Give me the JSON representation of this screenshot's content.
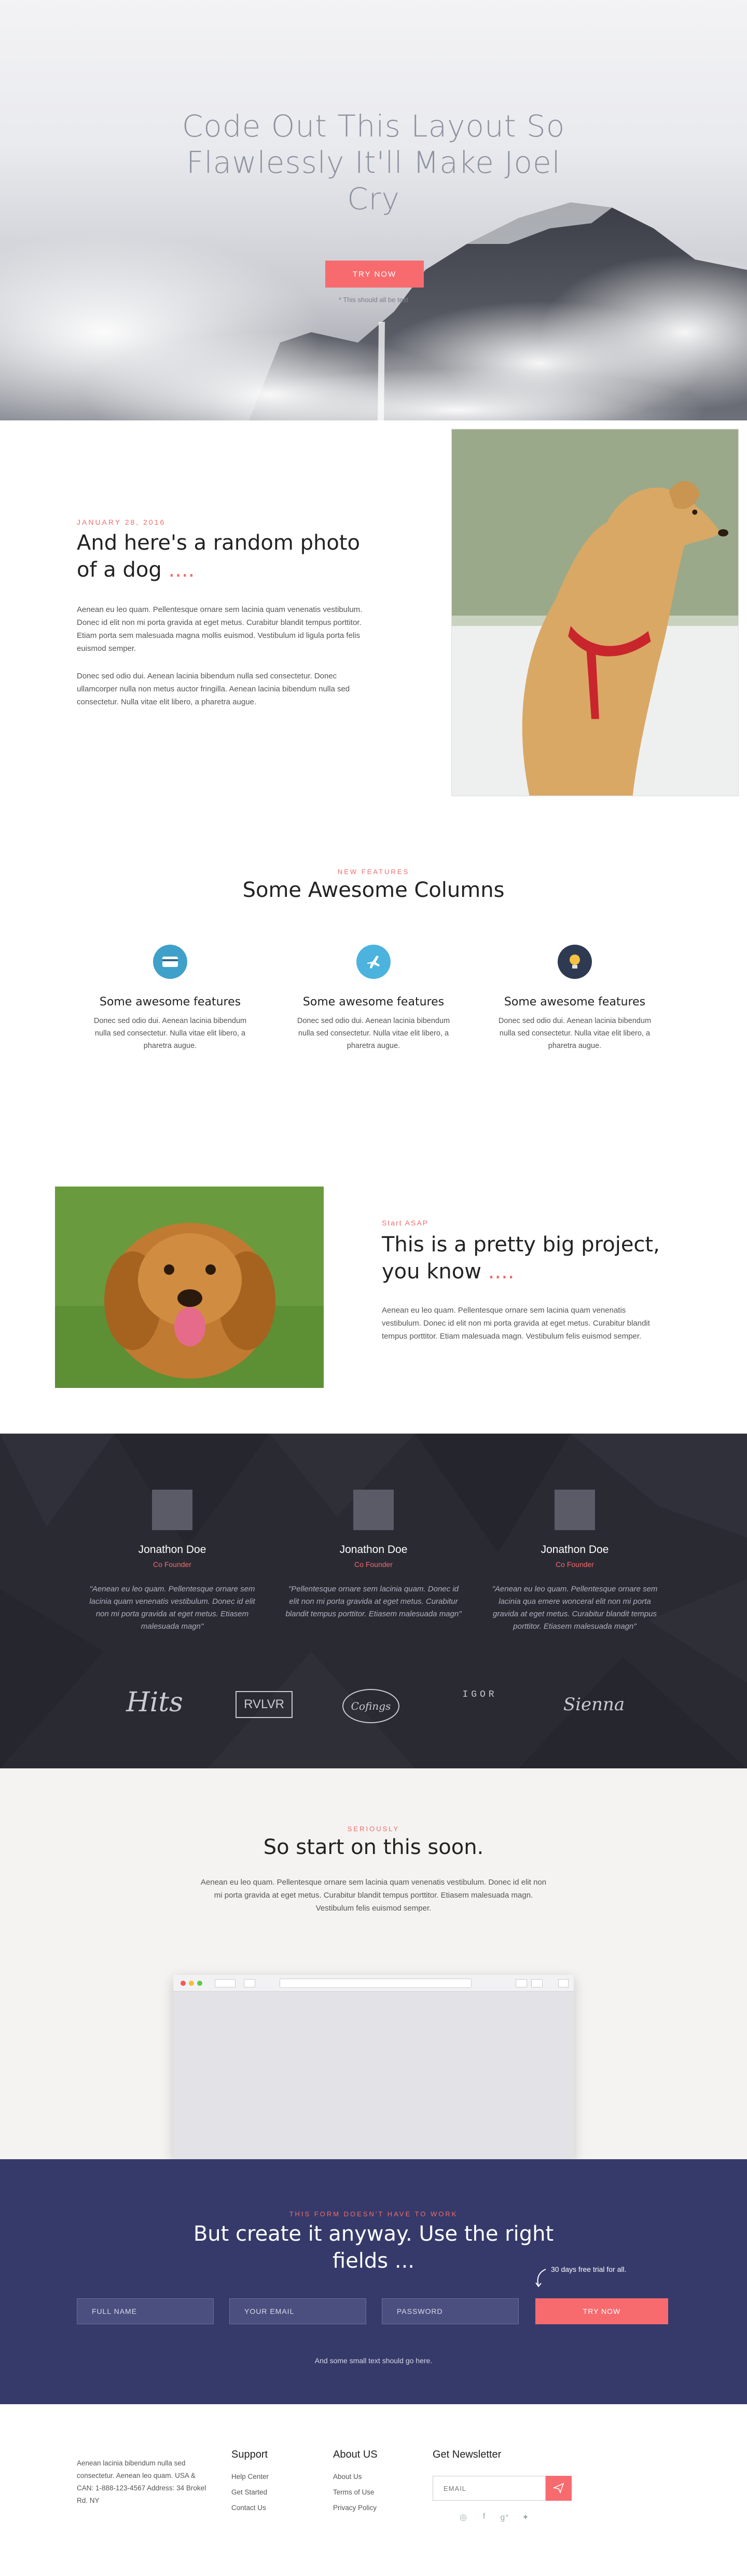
{
  "hero": {
    "title": "Code Out This Layout So Flawlessly It'll Make Joel Cry",
    "cta": "TRY NOW",
    "note": "* This should all be text"
  },
  "article": {
    "date": "JANUARY 28, 2016",
    "title": "And here's a random photo of a dog",
    "title_accent": "....",
    "para1": "Aenean eu leo quam. Pellentesque ornare sem lacinia quam venenatis vestibulum. Donec id elit non mi porta gravida at eget metus. Curabitur blandit tempus porttitor. Etiam porta sem malesuada magna mollis euismod. Vestibulum id ligula porta felis euismod semper.",
    "para2": "Donec sed odio dui. Aenean lacinia bibendum nulla sed consectetur. Donec ullamcorper nulla non metus auctor fringilla. Aenean lacinia bibendum nulla sed consectetur. Nulla vitae elit libero, a pharetra augue."
  },
  "features": {
    "eyebrow": "NEW FEATURES",
    "title": "Some Awesome Columns",
    "items": [
      {
        "icon": "credit-card-icon",
        "color": "#3fa1c9",
        "title": "Some awesome features",
        "text": "Donec sed odio dui. Aenean lacinia bibendum nulla sed consectetur. Nulla vitae elit libero, a pharetra augue."
      },
      {
        "icon": "airplane-icon",
        "color": "#4bb3de",
        "title": "Some awesome features",
        "text": "Donec sed odio dui. Aenean lacinia bibendum nulla sed consectetur. Nulla vitae elit libero, a pharetra augue."
      },
      {
        "icon": "lightbulb-icon",
        "color": "#2e3a52",
        "title": "Some awesome features",
        "text": "Donec sed odio dui. Aenean lacinia bibendum nulla sed consectetur. Nulla vitae elit libero, a pharetra augue."
      }
    ]
  },
  "project": {
    "eyebrow": "Start ASAP",
    "title": "This is a pretty big project, you know",
    "title_accent": "....",
    "text": "Aenean eu leo quam. Pellentesque ornare sem lacinia quam venenatis vestibulum. Donec id elit non mi porta gravida at eget metus. Curabitur blandit tempus porttitor. Etiam malesuada magn. Vestibulum felis euismod semper."
  },
  "testimonials": [
    {
      "name": "Jonathon Doe",
      "role": "Co Founder",
      "quote": "\"Aenean eu leo quam. Pellentesque ornare sem lacinia quam venenatis vestibulum. Donec id elit non mi porta gravida at eget metus. Etiasem malesuada magn\""
    },
    {
      "name": "Jonathon Doe",
      "role": "Co Founder",
      "quote": "\"Pellentesque ornare sem lacinia quam. Donec id elit non mi porta gravida at eget metus. Curabitur blandit tempus porttitor. Etiasem malesuada magn\""
    },
    {
      "name": "Jonathon Doe",
      "role": "Co Founder",
      "quote": "\"Aenean eu leo quam. Pellentesque ornare sem lacinia qua emere wonceral elit non mi porta gravida at eget metus. Curabitur blandit tempus porttitor. Etiasem malesuada magn\""
    }
  ],
  "logos": [
    "Hits",
    "RVLVR",
    "Cofings",
    "IGOR",
    "Sienna"
  ],
  "start": {
    "eyebrow": "SERIOUSLY",
    "title": "So start on this soon.",
    "text": "Aenean eu leo quam. Pellentesque ornare sem lacinia quam venenatis vestibulum. Donec id elit non mi porta gravida at eget metus. Curabitur blandit tempus porttitor. Etiasem malesuada magn. Vestibulum felis euismod semper."
  },
  "form": {
    "eyebrow": "THIS FORM DOESN'T HAVE TO WORK",
    "title": "But create it anyway. Use the right fields",
    "title_accent": "...",
    "trial": "30 days free trial for all.",
    "full_name": "FULL NAME",
    "email": "YOUR EMAIL",
    "password": "PASSWORD",
    "submit": "TRY NOW",
    "note": "And some small text should go here."
  },
  "footer": {
    "address": "Aenean lacinia bibendum nulla sed consectetur. Aenean leo quam. USA & CAN: 1-888-123-4567 Address: 34 Brokel Rd. NY",
    "support_title": "Support",
    "support_links": [
      "Help Center",
      "Get Started",
      "Contact Us"
    ],
    "about_title": "About US",
    "about_links": [
      "About Us",
      "Terms of Use",
      "Privacy Policy"
    ],
    "newsletter_title": "Get Newsletter",
    "newsletter_placeholder": "EMAIL",
    "social": [
      "dribbble-icon",
      "facebook-icon",
      "google-plus-icon",
      "twitter-icon"
    ]
  }
}
